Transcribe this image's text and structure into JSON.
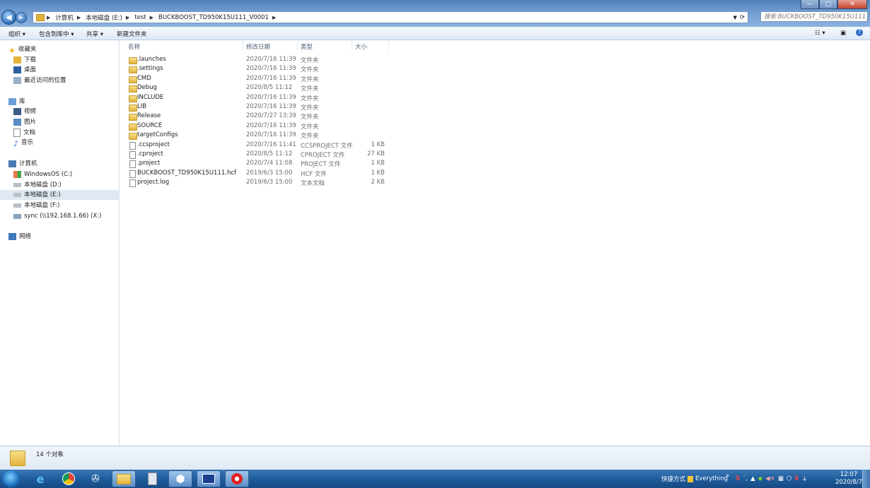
{
  "window": {
    "buttons": {
      "minimize": "—",
      "maximize": "□",
      "close": "✕"
    }
  },
  "address": {
    "segments": [
      "计算机",
      "本地磁盘 (E:)",
      "test",
      "BUCKBOOST_TD950K15U111_V0001"
    ],
    "search_placeholder": "搜索 BUCKBOOST_TD950K15U111_V0001"
  },
  "toolbar": {
    "organize": "组织 ▾",
    "include_library": "包含到库中 ▾",
    "share": "共享 ▾",
    "new_folder": "新建文件夹"
  },
  "sidebar": {
    "favorites": "收藏夹",
    "downloads": "下载",
    "desktop": "桌面",
    "recent": "最近访问的位置",
    "libraries": "库",
    "videos": "视频",
    "pictures": "图片",
    "documents": "文档",
    "music": "音乐",
    "computer": "计算机",
    "drive_c": "WindowsOS (C:)",
    "drive_d": "本地磁盘 (D:)",
    "drive_e": "本地磁盘 (E:)",
    "drive_f": "本地磁盘 (F:)",
    "drive_x": "sync (\\\\192.168.1.66) (X:)",
    "network": "网络"
  },
  "columns": {
    "name": "名称",
    "date": "修改日期",
    "type": "类型",
    "size": "大小"
  },
  "files": [
    {
      "name": ".launches",
      "date": "2020/7/16 11:39",
      "type": "文件夹",
      "size": ""
    },
    {
      "name": ".settings",
      "date": "2020/7/16 11:39",
      "type": "文件夹",
      "size": ""
    },
    {
      "name": "CMD",
      "date": "2020/7/16 11:39",
      "type": "文件夹",
      "size": ""
    },
    {
      "name": "Debug",
      "date": "2020/8/5 11:12",
      "type": "文件夹",
      "size": ""
    },
    {
      "name": "INCLUDE",
      "date": "2020/7/16 11:39",
      "type": "文件夹",
      "size": ""
    },
    {
      "name": "LIB",
      "date": "2020/7/16 11:39",
      "type": "文件夹",
      "size": ""
    },
    {
      "name": "Release",
      "date": "2020/7/27 13:39",
      "type": "文件夹",
      "size": ""
    },
    {
      "name": "SOURCE",
      "date": "2020/7/16 11:39",
      "type": "文件夹",
      "size": ""
    },
    {
      "name": "targetConfigs",
      "date": "2020/7/16 11:39",
      "type": "文件夹",
      "size": ""
    },
    {
      "name": ".ccsproject",
      "date": "2020/7/16 11:41",
      "type": "CCSPROJECT 文件",
      "size": "1 KB"
    },
    {
      "name": ".cproject",
      "date": "2020/8/5 11:12",
      "type": "CPROJECT 文件",
      "size": "27 KB"
    },
    {
      "name": ".project",
      "date": "2020/7/4 11:08",
      "type": "PROJECT 文件",
      "size": "1 KB"
    },
    {
      "name": "BUCKBOOST_TD950K15U111.hcf",
      "date": "2019/6/3 15:00",
      "type": "HCF 文件",
      "size": "1 KB"
    },
    {
      "name": "project.log",
      "date": "2019/6/3 15:00",
      "type": "文本文档",
      "size": "2 KB"
    }
  ],
  "status": {
    "count": "14 个对象"
  },
  "taskbar": {
    "quick_launch": "快捷方式",
    "everything": "Everything",
    "overflow": "»",
    "time": "12:07",
    "date": "2020/8/7"
  },
  "colors": {
    "accent": "#1f5c9c",
    "selection": "#dfe7f1",
    "folder": "#e3b43b"
  }
}
